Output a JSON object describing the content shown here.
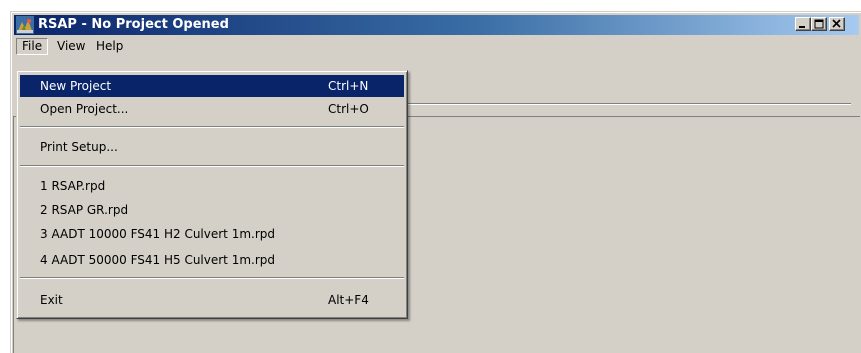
{
  "window": {
    "title": "RSAP - No Project Opened",
    "app_icon": "rsap-app-icon",
    "buttons": [
      "minimize-icon",
      "restore-icon",
      "close-icon"
    ]
  },
  "menubar": {
    "items": [
      {
        "label": "File"
      },
      {
        "label": "View"
      },
      {
        "label": "Help"
      }
    ]
  },
  "file_menu": {
    "new_project": {
      "label": "New Project",
      "shortcut": "Ctrl+N"
    },
    "open_project": {
      "label": "Open Project...",
      "shortcut": "Ctrl+O"
    },
    "print_setup": {
      "label": "Print Setup..."
    },
    "recent": [
      {
        "label": "1 RSAP.rpd"
      },
      {
        "label": "2 RSAP GR.rpd"
      },
      {
        "label": "3 AADT 10000 FS41 H2 Culvert 1m.rpd"
      },
      {
        "label": "4 AADT 50000 FS41 H5 Culvert 1m.rpd"
      }
    ],
    "exit": {
      "label": "Exit",
      "shortcut": "Alt+F4"
    }
  },
  "colors": {
    "title_active": "#0a246a",
    "menu_highlight": "#0a246a",
    "face": "#d4d0c8"
  }
}
